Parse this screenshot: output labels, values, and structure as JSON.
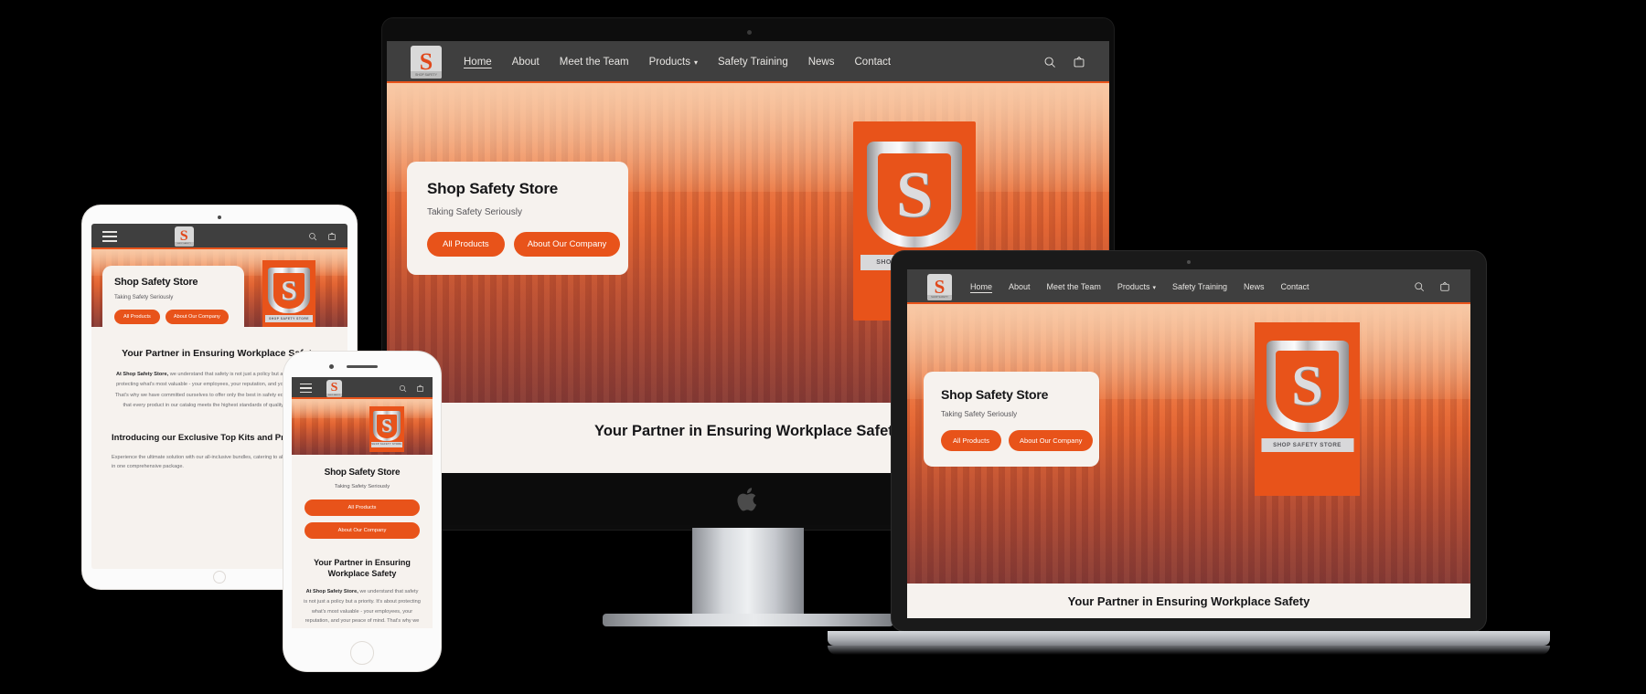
{
  "brand": {
    "name": "Shop Safety Store",
    "logo_letter": "S",
    "logo_band": "SHOP SAFETY STORE",
    "shield_letter": "S",
    "shield_ribbon": "SHOP SAFETY STORE"
  },
  "colors": {
    "accent": "#e8531a",
    "nav_bg": "#3f3f3f",
    "page_bg": "#f6f2ee",
    "text_dark": "#161618",
    "text_muted": "#6a6a6e",
    "backdrop": "#000000"
  },
  "nav": {
    "items": [
      {
        "label": "Home",
        "active": true,
        "caret": false
      },
      {
        "label": "About",
        "active": false,
        "caret": false
      },
      {
        "label": "Meet the Team",
        "active": false,
        "caret": false
      },
      {
        "label": "Products",
        "active": false,
        "caret": true
      },
      {
        "label": "Safety Training",
        "active": false,
        "caret": false
      },
      {
        "label": "News",
        "active": false,
        "caret": false
      },
      {
        "label": "Contact",
        "active": false,
        "caret": false
      }
    ],
    "icons": [
      {
        "name": "search-icon"
      },
      {
        "name": "cart-icon"
      }
    ],
    "mobile_menu_icon": "hamburger-icon"
  },
  "hero": {
    "title": "Shop Safety Store",
    "subtitle": "Taking Safety Seriously",
    "primary_button": "All Products",
    "secondary_button": "About Our Company"
  },
  "banner": {
    "headline": "Your Partner in Ensuring Workplace Safety"
  },
  "sections": [
    {
      "heading": "Your Partner in Ensuring Workplace Safety",
      "body_lead": "At Shop Safety Store,",
      "body": " we understand that safety is not just a policy but a priority. It's about protecting what's most valuable - your employees, your reputation, and your peace of mind. That's why we have committed ourselves to offer only the best in safety equipment, ensuring that every product in our catalog meets the highest standards of quality and reliability."
    },
    {
      "heading": "Introducing our Exclusive Top Kits and Products!",
      "body_lead": "",
      "body": "Experience the ultimate solution with our all-inclusive bundles, catering to all your safety needs in one comprehensive package."
    }
  ],
  "devices": [
    {
      "name": "imac",
      "label": "Desktop"
    },
    {
      "name": "ipad",
      "label": "Tablet"
    },
    {
      "name": "iphone",
      "label": "Mobile"
    },
    {
      "name": "macbook",
      "label": "Laptop"
    }
  ]
}
